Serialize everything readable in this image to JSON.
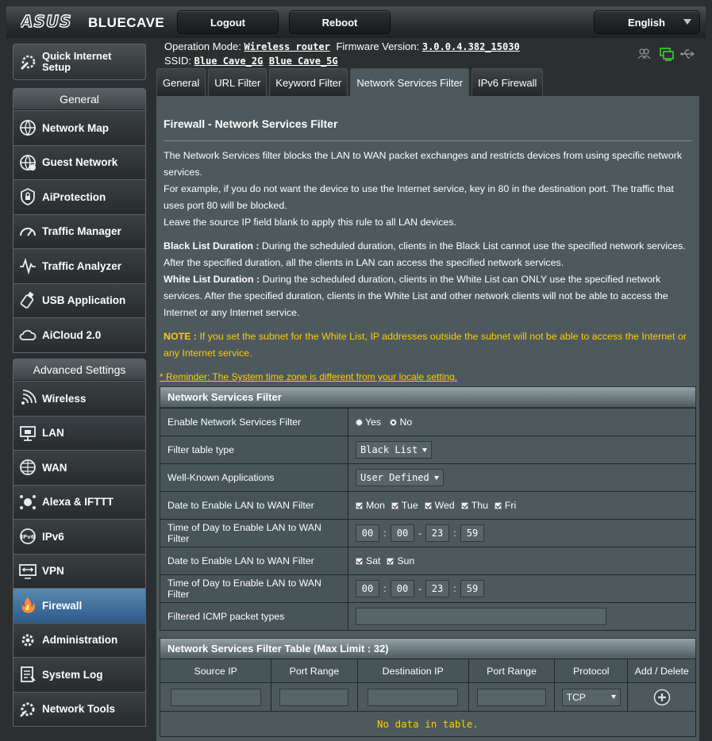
{
  "header": {
    "brand": "ASUS",
    "model": "BLUECAVE",
    "logout_label": "Logout",
    "reboot_label": "Reboot",
    "language": "English"
  },
  "status": {
    "op_mode_label": "Operation Mode:",
    "op_mode_value": "Wireless router",
    "firmware_label": "Firmware Version:",
    "firmware_value": "3.0.0.4.382_15030",
    "ssid_label": "SSID:",
    "ssid_2g": "Blue Cave_2G",
    "ssid_5g": "Blue Cave_5G",
    "icons": [
      "clients-icon",
      "network-status-icon",
      "usb-icon"
    ]
  },
  "sidebar": {
    "quick_setup": "Quick Internet Setup",
    "general_header": "General",
    "general_items": [
      {
        "label": "Network Map",
        "icon": "network-map-icon"
      },
      {
        "label": "Guest Network",
        "icon": "guest-network-icon"
      },
      {
        "label": "AiProtection",
        "icon": "aiprotection-icon"
      },
      {
        "label": "Traffic Manager",
        "icon": "traffic-manager-icon"
      },
      {
        "label": "Traffic Analyzer",
        "icon": "traffic-analyzer-icon"
      },
      {
        "label": "USB Application",
        "icon": "usb-application-icon"
      },
      {
        "label": "AiCloud 2.0",
        "icon": "aicloud-icon"
      }
    ],
    "advanced_header": "Advanced Settings",
    "advanced_items": [
      {
        "label": "Wireless",
        "icon": "wireless-icon"
      },
      {
        "label": "LAN",
        "icon": "lan-icon"
      },
      {
        "label": "WAN",
        "icon": "wan-icon"
      },
      {
        "label": "Alexa & IFTTT",
        "icon": "alexa-icon"
      },
      {
        "label": "IPv6",
        "icon": "ipv6-icon"
      },
      {
        "label": "VPN",
        "icon": "vpn-icon"
      },
      {
        "label": "Firewall",
        "icon": "firewall-icon",
        "active": true
      },
      {
        "label": "Administration",
        "icon": "administration-icon"
      },
      {
        "label": "System Log",
        "icon": "system-log-icon"
      },
      {
        "label": "Network Tools",
        "icon": "network-tools-icon"
      }
    ]
  },
  "tabs": [
    "General",
    "URL Filter",
    "Keyword Filter",
    "Network Services Filter",
    "IPv6 Firewall"
  ],
  "active_tab": "Network Services Filter",
  "page": {
    "title": "Firewall - Network Services Filter",
    "desc_lines": [
      "The Network Services filter blocks the LAN to WAN packet exchanges and restricts devices from using specific network services.",
      "For example, if you do not want the device to use the Internet service, key in 80 in the destination port. The traffic that uses port 80 will be blocked.",
      "Leave the source IP field blank to apply this rule to all LAN devices."
    ],
    "black_list_label": "Black List Duration :",
    "black_list_text": " During the scheduled duration, clients in the Black List cannot use the specified network services. After the specified duration, all the clients in LAN can access the specified network services.",
    "white_list_label": "White List Duration :",
    "white_list_text": " During the scheduled duration, clients in the White List can ONLY use the specified network services. After the specified duration, clients in the White List and other network clients will not be able to access the Internet or any Internet service.",
    "note_label": "NOTE :",
    "note_text": " If you set the subnet for the White List, IP addresses outside the subnet will not be able to access the Internet or any Internet service.",
    "reminder": "* Reminder: The System time zone is different from your locale setting."
  },
  "filter": {
    "header": "Network Services Filter",
    "enable_label": "Enable Network Services Filter",
    "enable_yes": "Yes",
    "enable_no": "No",
    "enable_selected": "No",
    "table_type_label": "Filter table type",
    "table_type_value": "Black List",
    "apps_label": "Well-Known Applications",
    "apps_value": "User Defined",
    "weekday_label": "Date to Enable LAN to WAN Filter",
    "weekdays": [
      "Mon",
      "Tue",
      "Wed",
      "Thu",
      "Fri"
    ],
    "weekday_time_label": "Time of Day to Enable LAN to WAN Filter",
    "weekday_time": [
      "00",
      "00",
      "23",
      "59"
    ],
    "weekend_label": "Date to Enable LAN to WAN Filter",
    "weekend": [
      "Sat",
      "Sun"
    ],
    "weekend_time_label": "Time of Day to Enable LAN to WAN Filter",
    "weekend_time": [
      "00",
      "00",
      "23",
      "59"
    ],
    "icmp_label": "Filtered ICMP packet types",
    "icmp_value": ""
  },
  "filter_list": {
    "header": "Network Services Filter Table (Max Limit : 32)",
    "columns": [
      "Source IP",
      "Port Range",
      "Destination IP",
      "Port Range",
      "Protocol",
      "Add / Delete"
    ],
    "protocol_value": "TCP",
    "empty_text": "No data in table."
  }
}
